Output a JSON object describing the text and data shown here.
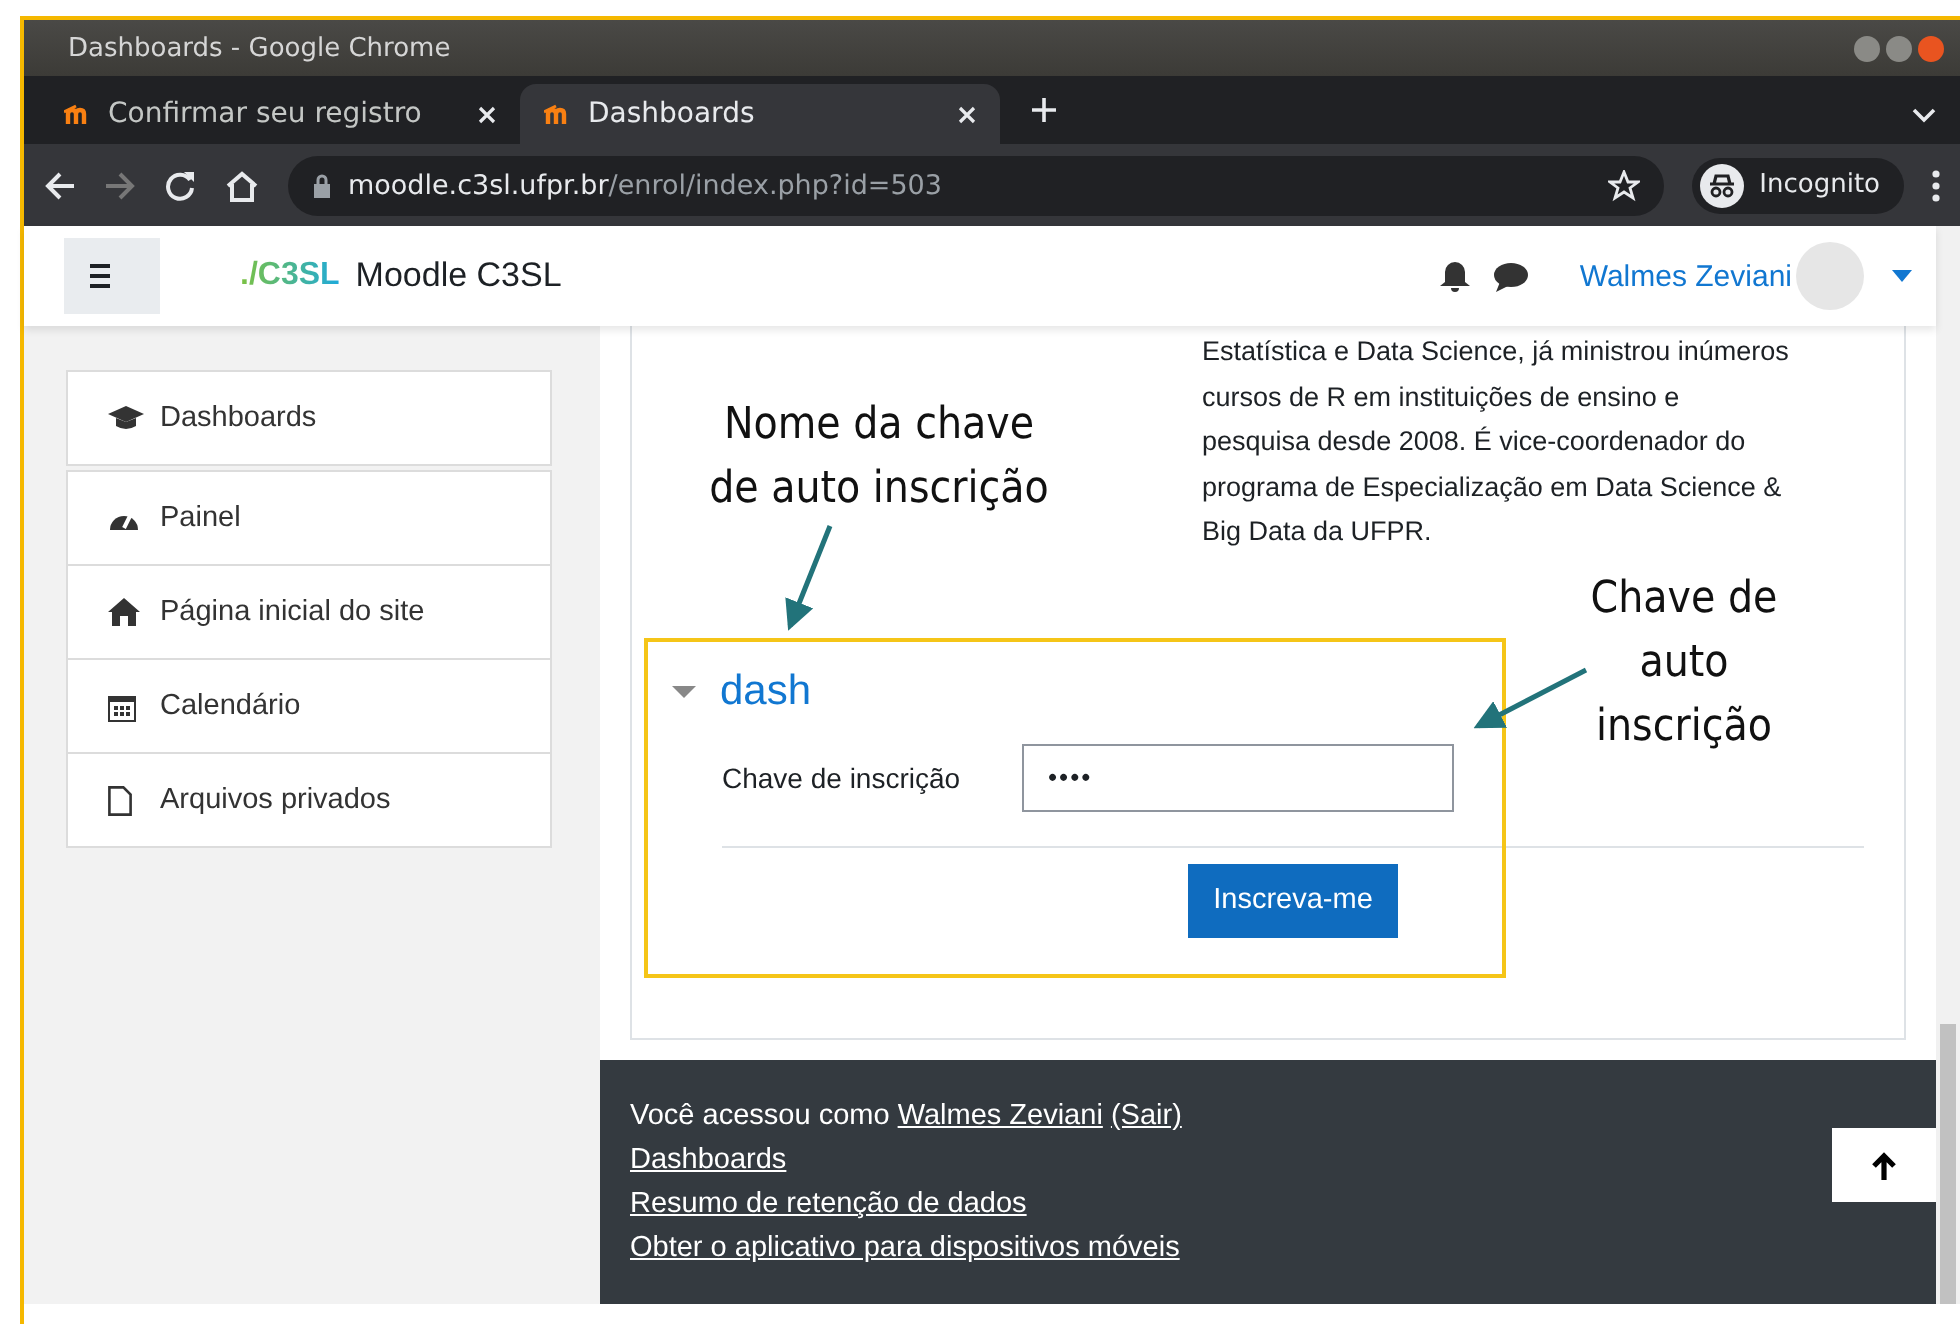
{
  "window": {
    "title": "Dashboards - Google Chrome"
  },
  "tabs": [
    {
      "label": "Confirmar seu registro",
      "selected": false
    },
    {
      "label": "Dashboards",
      "selected": true
    }
  ],
  "address_bar": {
    "host": "moodle.c3sl.ufpr.br",
    "path": "/enrol/index.php?id=503",
    "profile": "Incognito"
  },
  "navbar": {
    "logo": "./C3SL",
    "site_name": "Moodle C3SL",
    "user_name": "Walmes Zeviani"
  },
  "sidebar": {
    "items": [
      {
        "label": "Dashboards"
      },
      {
        "label": "Painel"
      },
      {
        "label": "Página inicial do site"
      },
      {
        "label": "Calendário"
      },
      {
        "label": "Arquivos privados"
      }
    ]
  },
  "course": {
    "description": "Estatística e Data Science, já ministrou inúmeros cursos de R em instituições de ensino e pesquisa desde 2008. É vice-coordenador do programa de Especialização em Data Science & Big Data da UFPR."
  },
  "enrol": {
    "title": "dash",
    "expanded": true,
    "field_label": "Chave de inscrição",
    "field_value": "••••",
    "button": "Inscreva-me"
  },
  "footer": {
    "logged_in_text": "Você acessou como",
    "user_link": "Walmes Zeviani",
    "logout_link": "(Sair)",
    "links": [
      "Dashboards",
      "Resumo de retenção de dados",
      "Obter o aplicativo para dispositivos móveis"
    ]
  },
  "annotations": [
    {
      "text": "Nome da chave de auto inscrição"
    },
    {
      "text": "Chave de auto inscrição"
    }
  ]
}
